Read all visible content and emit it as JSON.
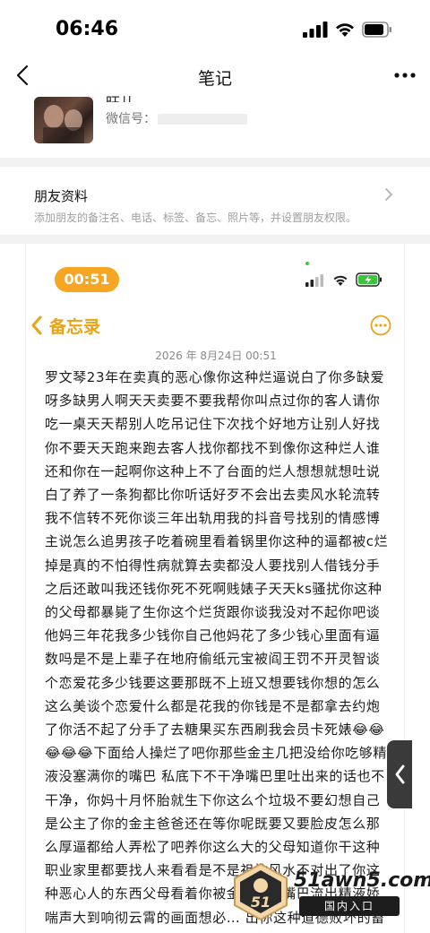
{
  "status_bar": {
    "time": "06:46"
  },
  "nav": {
    "title": "笔记"
  },
  "profile": {
    "name_partial": "旺儿",
    "wechat_label": "微信号："
  },
  "friend_info": {
    "title": "朋友资料",
    "description": "添加朋友的备注名、电话、标签、备忘、照片等，并设置朋友权限。"
  },
  "embedded_screenshot": {
    "timer": "00:51",
    "back_label": "备忘录",
    "date": "2026 年 8月24日 00:51",
    "body_text": "罗文琴23年在卖真的恶心像你这种烂逼说白了你多缺爱呀多缺男人啊天天卖要不要我帮你叫点过你的客人请你吃一桌天天帮别人吃吊记住下次找个好地方让别人好找你不要天天跑来跑去客人找你都找不到像你这种烂人谁还和你在一起啊你这种上不了台面的烂人想想就想吐说白了养了一条狗都比你听话好歹不会出去卖风水轮流转我不信转不死你谈三年出轨用我的抖音号找别的情感博主说怎么追男孩子吃着碗里看着锅里你这种的逼都被c烂掉是真的不怕得性病就算去卖都没人要找别人借钱分手之后还敢叫我还钱你死不死啊贱婊子天天ks骚扰你这种的父母都暴毙了生你这个烂货跟你谈我没对不起你吧谈他妈三年花我多少钱你自己他妈花了多少钱心里面有逼数吗是不是上辈子在地府偷纸元宝被阎王罚不开灵智谈个恋爱花多少钱要这要那既不上班又想要钱你想的怎么这么美谈个恋爱什么都是花我的你钱是不是都拿去约炮了你活不起了分手了去糖果买东西刷我会员卡死婊😂😂😂😂😂下面给人操烂了吧你那些金主几把没给你吃够精液没塞满你的嘴巴 私底下不干净嘴巴里吐出来的话也不干净，你妈十月怀胎就生下你这么个垃圾不要幻想自己是公主了你的金主爸爸还在等你呢既要又要脸皮怎么那么厚逼都给人弄松了吧养你这么大的父母知道你干这种职业家里都要找人来看看是不是祖坟风水不对出了你这种恶心人的东西父母看着你被金主操到嘴巴流出精液娇喘声大到响彻云霄的画面想必… 出你这种道德败坏的畜生"
  },
  "watermark": {
    "badge_text": "51",
    "site": "51awn5.com",
    "bar_text": "国内入口"
  },
  "colors": {
    "accent_orange": "#f6a622",
    "memo_yellow": "#e9a316",
    "battery_green": "#3cc43c"
  }
}
